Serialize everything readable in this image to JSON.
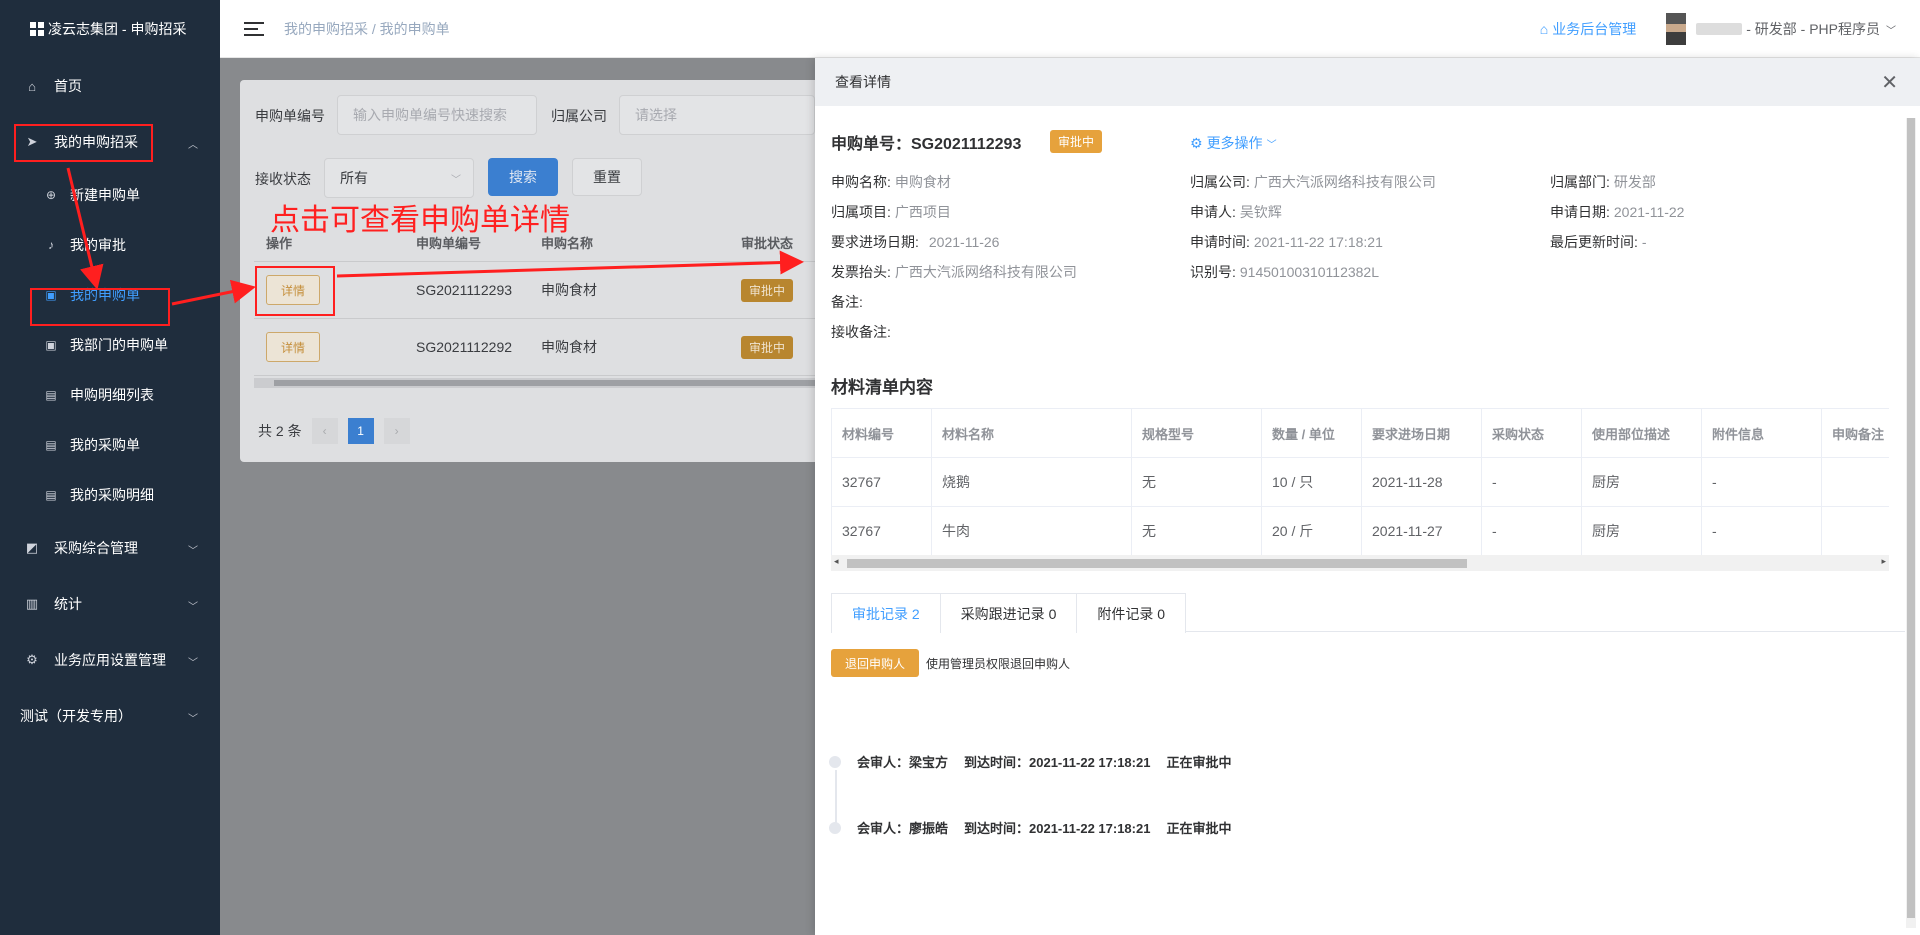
{
  "app": {
    "title": "凌云志集团 - 申购招采"
  },
  "sidebar": {
    "home": "首页",
    "my_purchase": "我的申购招采",
    "sub": [
      "新建申购单",
      "我的审批",
      "我的申购单",
      "我部门的申购单",
      "申购明细列表",
      "我的采购单",
      "我的采购明细"
    ],
    "groups": [
      "采购综合管理",
      "统计",
      "业务应用设置管理",
      "测试（开发专用）"
    ]
  },
  "header": {
    "breadcrumb": "我的申购招采 / 我的申购单",
    "backend_link": "业务后台管理",
    "user": "- 研发部 - PHP程序员"
  },
  "filter": {
    "code_label": "申购单编号",
    "code_placeholder": "输入申购单编号快速搜索",
    "company_label": "归属公司",
    "company_placeholder": "请选择",
    "status_label": "接收状态",
    "status_value": "所有",
    "search": "搜索",
    "reset": "重置"
  },
  "list": {
    "headers": [
      "操作",
      "申购单编号",
      "申购名称",
      "审批状态"
    ],
    "rows": [
      {
        "action": "详情",
        "code": "SG2021112293",
        "name": "申购食材",
        "status": "审批中"
      },
      {
        "action": "详情",
        "code": "SG2021112292",
        "name": "申购食材",
        "status": "审批中"
      }
    ],
    "total": "共 2 条",
    "page": "1"
  },
  "annotation": "点击可查看申购单详情",
  "drawer": {
    "title": "查看详情",
    "order_title": "申购单号：SG2021112293",
    "status_tag": "审批中",
    "more_ops": "更多操作",
    "fields": {
      "name_k": "申购名称:",
      "name_v": "申购食材",
      "company_k": "归属公司:",
      "company_v": "广西大汽派网络科技有限公司",
      "dept_k": "归属部门:",
      "dept_v": "研发部",
      "project_k": "归属项目:",
      "project_v": "广西项目",
      "applicant_k": "申请人:",
      "applicant_v": "吴钦辉",
      "apply_date_k": "申请日期:",
      "apply_date_v": "2021-11-22",
      "entry_date_k": "要求进场日期:",
      "entry_date_v": "2021-11-26",
      "apply_time_k": "申请时间:",
      "apply_time_v": "2021-11-22 17:18:21",
      "updated_k": "最后更新时间:",
      "updated_v": "-",
      "invoice_k": "发票抬头:",
      "invoice_v": "广西大汽派网络科技有限公司",
      "taxid_k": "识别号:",
      "taxid_v": "91450100310112382L",
      "remark_k": "备注:",
      "recv_remark_k": "接收备注:"
    },
    "materials_title": "材料清单内容",
    "materials_headers": [
      "材料编号",
      "材料名称",
      "规格型号",
      "数量 / 单位",
      "要求进场日期",
      "采购状态",
      "使用部位描述",
      "附件信息",
      "申购备注"
    ],
    "materials_rows": [
      [
        "32767",
        "烧鹅",
        "无",
        "10 / 只",
        "2021-11-28",
        "-",
        "厨房",
        "-",
        ""
      ],
      [
        "32767",
        "牛肉",
        "无",
        "20 / 斤",
        "2021-11-27",
        "-",
        "厨房",
        "-",
        ""
      ]
    ],
    "tabs": [
      "审批记录 2",
      "采购跟进记录 0",
      "附件记录 0"
    ],
    "return_btn": "退回申购人",
    "return_hint": "使用管理员权限退回申购人",
    "timeline": [
      {
        "reviewer": "会审人：梁宝方",
        "arrive": "到达时间：2021-11-22 17:18:21",
        "state": "正在审批中"
      },
      {
        "reviewer": "会审人：廖振皓",
        "arrive": "到达时间：2021-11-22 17:18:21",
        "state": "正在审批中"
      }
    ]
  }
}
